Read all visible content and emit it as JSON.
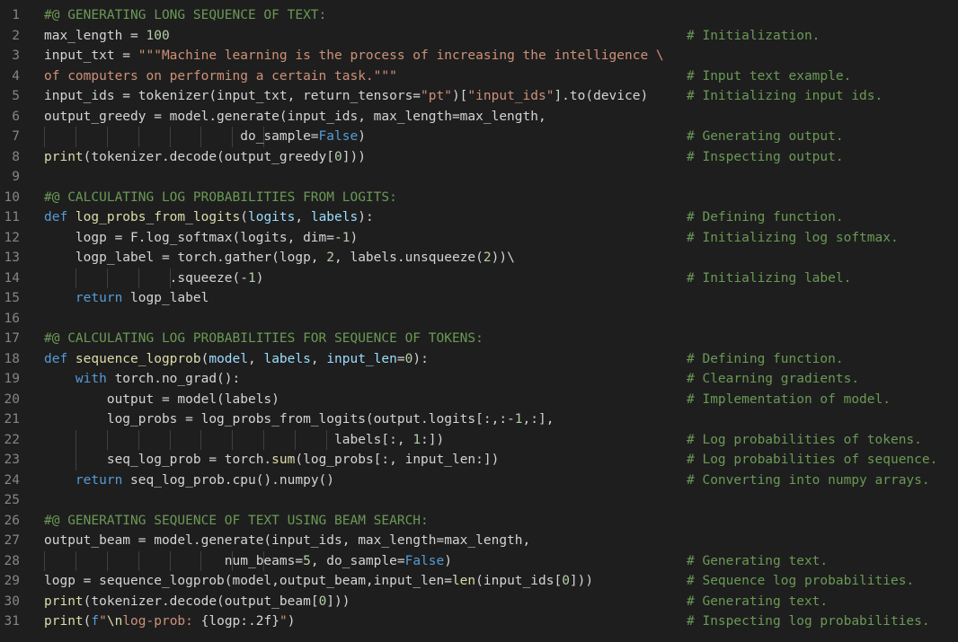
{
  "editor": {
    "lines": [
      {
        "num": "1",
        "segments": [
          {
            "t": "#@ GENERATING LONG SEQUENCE OF TEXT:",
            "c": "c"
          }
        ],
        "comment": ""
      },
      {
        "num": "2",
        "segments": [
          {
            "t": "max_length = ",
            "c": "p"
          },
          {
            "t": "100",
            "c": "n"
          }
        ],
        "comment": "# Initialization."
      },
      {
        "num": "3",
        "segments": [
          {
            "t": "input_txt = ",
            "c": "p"
          },
          {
            "t": "\"\"\"Machine learning is the process of increasing the intelligence \\",
            "c": "s"
          }
        ],
        "comment": ""
      },
      {
        "num": "4",
        "segments": [
          {
            "t": "of computers on performing a certain task.\"\"\"",
            "c": "s"
          }
        ],
        "comment": "# Input text example."
      },
      {
        "num": "5",
        "segments": [
          {
            "t": "input_ids = tokenizer(input_txt, return_tensors=",
            "c": "p"
          },
          {
            "t": "\"pt\"",
            "c": "s"
          },
          {
            "t": ")[",
            "c": "p"
          },
          {
            "t": "\"input_ids\"",
            "c": "s"
          },
          {
            "t": "].to(device)",
            "c": "p"
          }
        ],
        "comment": "# Initializing input ids."
      },
      {
        "num": "6",
        "segments": [
          {
            "t": "output_greedy = model.generate(input_ids, max_length=max_length,",
            "c": "p"
          }
        ],
        "comment": ""
      },
      {
        "num": "7",
        "segments": [
          {
            "t": "                         do_sample=",
            "c": "p"
          },
          {
            "t": "False",
            "c": "k"
          },
          {
            "t": ")",
            "c": "p"
          }
        ],
        "comment": "# Generating output.",
        "guides": [
          0,
          1,
          2,
          3,
          4,
          5,
          6,
          7
        ]
      },
      {
        "num": "8",
        "segments": [
          {
            "t": "print",
            "c": "f"
          },
          {
            "t": "(tokenizer.decode(output_greedy[",
            "c": "p"
          },
          {
            "t": "0",
            "c": "n"
          },
          {
            "t": "]))",
            "c": "p"
          }
        ],
        "comment": "# Inspecting output."
      },
      {
        "num": "9",
        "segments": [],
        "comment": ""
      },
      {
        "num": "10",
        "segments": [
          {
            "t": "#@ CALCULATING LOG PROBABILITIES FROM LOGITS:",
            "c": "c"
          }
        ],
        "comment": ""
      },
      {
        "num": "11",
        "segments": [
          {
            "t": "def ",
            "c": "k"
          },
          {
            "t": "log_probs_from_logits",
            "c": "f"
          },
          {
            "t": "(",
            "c": "p"
          },
          {
            "t": "logits",
            "c": "v"
          },
          {
            "t": ", ",
            "c": "p"
          },
          {
            "t": "labels",
            "c": "v"
          },
          {
            "t": "):",
            "c": "p"
          }
        ],
        "comment": "# Defining function."
      },
      {
        "num": "12",
        "segments": [
          {
            "t": "    logp = F.log_softmax(logits, dim=-",
            "c": "p"
          },
          {
            "t": "1",
            "c": "n"
          },
          {
            "t": ")",
            "c": "p"
          }
        ],
        "comment": "# Initializing log softmax."
      },
      {
        "num": "13",
        "segments": [
          {
            "t": "    logp_label = torch.gather(logp, ",
            "c": "p"
          },
          {
            "t": "2",
            "c": "n"
          },
          {
            "t": ", labels.unsqueeze(",
            "c": "p"
          },
          {
            "t": "2",
            "c": "n"
          },
          {
            "t": "))\\",
            "c": "p"
          }
        ],
        "comment": ""
      },
      {
        "num": "14",
        "segments": [
          {
            "t": "                .squeeze(-",
            "c": "p"
          },
          {
            "t": "1",
            "c": "n"
          },
          {
            "t": ")",
            "c": "p"
          }
        ],
        "comment": "# Initializing label.",
        "guides": [
          1,
          2,
          3,
          4
        ]
      },
      {
        "num": "15",
        "segments": [
          {
            "t": "    ",
            "c": "p"
          },
          {
            "t": "return",
            "c": "k"
          },
          {
            "t": " logp_label",
            "c": "p"
          }
        ],
        "comment": ""
      },
      {
        "num": "16",
        "segments": [],
        "comment": ""
      },
      {
        "num": "17",
        "segments": [
          {
            "t": "#@ CALCULATING LOG PROBABILITIES FOR SEQUENCE OF TOKENS:",
            "c": "c"
          }
        ],
        "comment": ""
      },
      {
        "num": "18",
        "segments": [
          {
            "t": "def ",
            "c": "k"
          },
          {
            "t": "sequence_logprob",
            "c": "f"
          },
          {
            "t": "(",
            "c": "p"
          },
          {
            "t": "model",
            "c": "v"
          },
          {
            "t": ", ",
            "c": "p"
          },
          {
            "t": "labels",
            "c": "v"
          },
          {
            "t": ", ",
            "c": "p"
          },
          {
            "t": "input_len",
            "c": "v"
          },
          {
            "t": "=",
            "c": "p"
          },
          {
            "t": "0",
            "c": "n"
          },
          {
            "t": "):",
            "c": "p"
          }
        ],
        "comment": "# Defining function."
      },
      {
        "num": "19",
        "segments": [
          {
            "t": "    ",
            "c": "p"
          },
          {
            "t": "with",
            "c": "k"
          },
          {
            "t": " torch.no_grad():",
            "c": "p"
          }
        ],
        "comment": "# Clearning gradients."
      },
      {
        "num": "20",
        "segments": [
          {
            "t": "        output = model(labels)",
            "c": "p"
          }
        ],
        "comment": "# Implementation of model."
      },
      {
        "num": "21",
        "segments": [
          {
            "t": "        log_probs = log_probs_from_logits(output.logits[:,:-",
            "c": "p"
          },
          {
            "t": "1",
            "c": "n"
          },
          {
            "t": ",:],",
            "c": "p"
          }
        ],
        "comment": ""
      },
      {
        "num": "22",
        "segments": [
          {
            "t": "                                     labels[:, ",
            "c": "p"
          },
          {
            "t": "1",
            "c": "n"
          },
          {
            "t": ":])",
            "c": "p"
          }
        ],
        "comment": "# Log probabilities of tokens.",
        "guides": [
          1,
          2,
          3,
          4,
          5,
          6,
          7,
          8,
          9
        ]
      },
      {
        "num": "23",
        "segments": [
          {
            "t": "        seq_log_prob = torch.",
            "c": "p"
          },
          {
            "t": "sum",
            "c": "f"
          },
          {
            "t": "(log_probs[:, input_len:])",
            "c": "p"
          }
        ],
        "comment": "# Log probabilities of sequence.",
        "guides": [
          1
        ]
      },
      {
        "num": "24",
        "segments": [
          {
            "t": "    ",
            "c": "p"
          },
          {
            "t": "return",
            "c": "k"
          },
          {
            "t": " seq_log_prob.cpu().numpy()",
            "c": "p"
          }
        ],
        "comment": "# Converting into numpy arrays."
      },
      {
        "num": "25",
        "segments": [],
        "comment": ""
      },
      {
        "num": "26",
        "segments": [
          {
            "t": "#@ GENERATING SEQUENCE OF TEXT USING BEAM SEARCH:",
            "c": "c"
          }
        ],
        "comment": ""
      },
      {
        "num": "27",
        "segments": [
          {
            "t": "output_beam = model.generate(input_ids, max_length=max_length,",
            "c": "p"
          }
        ],
        "comment": ""
      },
      {
        "num": "28",
        "segments": [
          {
            "t": "                       num_beams=",
            "c": "p"
          },
          {
            "t": "5",
            "c": "n"
          },
          {
            "t": ", do_sample=",
            "c": "p"
          },
          {
            "t": "False",
            "c": "k"
          },
          {
            "t": ")",
            "c": "p"
          }
        ],
        "comment": "# Generating text.",
        "guides": [
          0,
          1,
          2,
          3,
          4,
          5,
          6,
          7
        ]
      },
      {
        "num": "29",
        "segments": [
          {
            "t": "logp = sequence_logprob(model,output_beam,input_len=",
            "c": "p"
          },
          {
            "t": "len",
            "c": "f"
          },
          {
            "t": "(input_ids[",
            "c": "p"
          },
          {
            "t": "0",
            "c": "n"
          },
          {
            "t": "]))",
            "c": "p"
          }
        ],
        "comment": "# Sequence log probabilities."
      },
      {
        "num": "30",
        "segments": [
          {
            "t": "print",
            "c": "f"
          },
          {
            "t": "(tokenizer.decode(output_beam[",
            "c": "p"
          },
          {
            "t": "0",
            "c": "n"
          },
          {
            "t": "]))",
            "c": "p"
          }
        ],
        "comment": "# Generating text."
      },
      {
        "num": "31",
        "segments": [
          {
            "t": "print",
            "c": "f"
          },
          {
            "t": "(",
            "c": "p"
          },
          {
            "t": "f",
            "c": "k"
          },
          {
            "t": "\"",
            "c": "s"
          },
          {
            "t": "\\n",
            "c": "f"
          },
          {
            "t": "log-prob: ",
            "c": "s"
          },
          {
            "t": "{logp:.2f}",
            "c": "p"
          },
          {
            "t": "\"",
            "c": "s"
          },
          {
            "t": ")",
            "c": "p"
          }
        ],
        "comment": "# Inspecting log probabilities."
      }
    ]
  },
  "colors": {
    "background": "#1e1e1e",
    "line_number": "#858585",
    "comment": "#6a9955",
    "string": "#ce9178",
    "keyword": "#569cd6",
    "function": "#dcdcaa",
    "parameter": "#9cdcfe",
    "number": "#b5cea8",
    "text": "#d4d4d4"
  }
}
